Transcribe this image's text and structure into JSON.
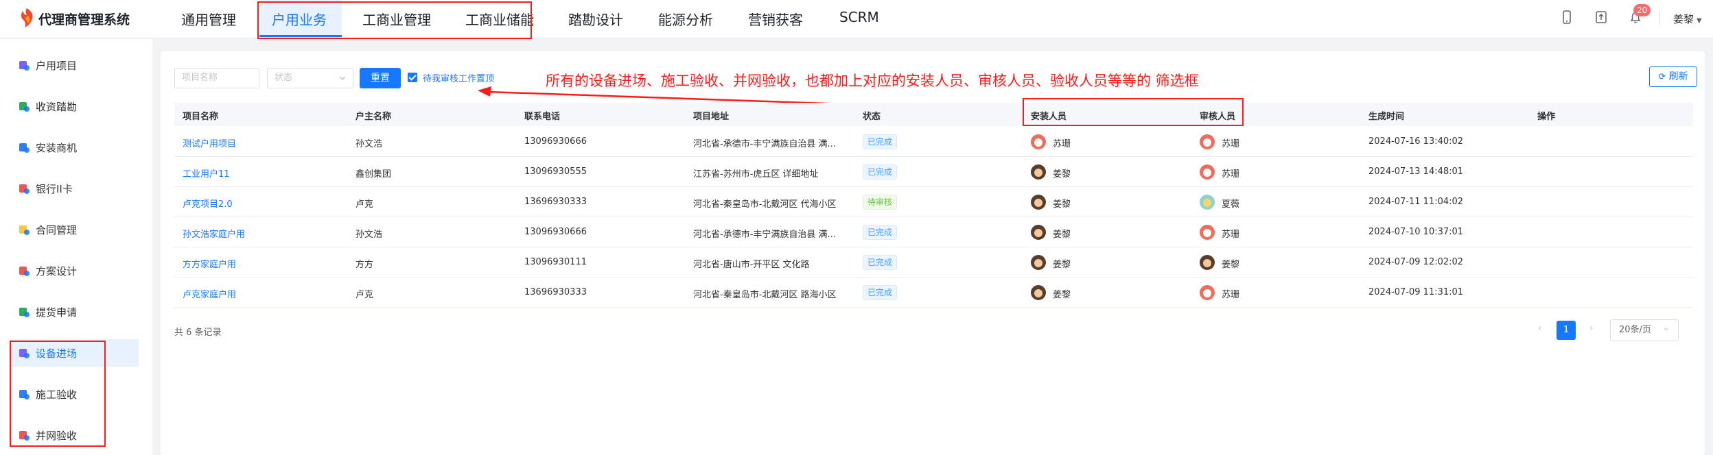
{
  "app": {
    "title": "代理商管理系统"
  },
  "nav": {
    "items": [
      "通用管理",
      "户用业务",
      "工商业管理",
      "工商业储能",
      "踏勘设计",
      "能源分析",
      "营销获客",
      "SCRM"
    ],
    "active_index": 1
  },
  "header": {
    "notification_count": "20",
    "user_name": "姜黎",
    "icons": [
      "mobile-icon",
      "upload-icon",
      "bell-icon"
    ]
  },
  "sidebar": {
    "items": [
      {
        "label": "户用项目",
        "icon": "house-project-icon",
        "color": "#7b61ff"
      },
      {
        "label": "收资踏勘",
        "icon": "survey-icon",
        "color": "#27ae60"
      },
      {
        "label": "安装商机",
        "icon": "opportunity-icon",
        "color": "#2f80ed"
      },
      {
        "label": "银行II卡",
        "icon": "bank-card-icon",
        "color": "#eb5757"
      },
      {
        "label": "合同管理",
        "icon": "contract-icon",
        "color": "#f2c94c"
      },
      {
        "label": "方案设计",
        "icon": "design-icon",
        "color": "#eb5757"
      },
      {
        "label": "提货申请",
        "icon": "pickup-icon",
        "color": "#27ae60"
      },
      {
        "label": "设备进场",
        "icon": "equipment-icon",
        "color": "#7b61ff"
      },
      {
        "label": "施工验收",
        "icon": "construction-icon",
        "color": "#2f80ed"
      },
      {
        "label": "并网验收",
        "icon": "grid-icon",
        "color": "#eb5757"
      }
    ],
    "active_index": 7
  },
  "filters": {
    "project_name_placeholder": "项目名称",
    "status_placeholder": "状态",
    "reset_label": "重置",
    "pin_pending_label": "待我审核工作置顶",
    "refresh_label": "刷新"
  },
  "annotation": "所有的设备进场、施工验收、并网验收，也都加上对应的安装人员、审核人员、验收人员等等的 筛选框",
  "table": {
    "columns": [
      "项目名称",
      "户主名称",
      "联系电话",
      "项目地址",
      "状态",
      "安装人员",
      "审核人员",
      "生成时间",
      "操作"
    ],
    "rows": [
      {
        "project": "测试户用项目",
        "owner": "孙文浩",
        "phone": "13096930666",
        "address": "河北省-承德市-丰宁满族自治县 满...",
        "status": "已完成",
        "installer": "苏珊",
        "reviewer": "苏珊",
        "created": "2024-07-16 13:40:02"
      },
      {
        "project": "工业用户11",
        "owner": "鑫创集团",
        "phone": "13096930555",
        "address": "江苏省-苏州市-虎丘区 详细地址",
        "status": "已完成",
        "installer": "姜黎",
        "reviewer": "苏珊",
        "created": "2024-07-13 14:48:01"
      },
      {
        "project": "卢克项目2.0",
        "owner": "卢克",
        "phone": "13696930333",
        "address": "河北省-秦皇岛市-北戴河区 代海小区",
        "status": "待审核",
        "installer": "姜黎",
        "reviewer": "夏薇",
        "created": "2024-07-11 11:04:02"
      },
      {
        "project": "孙文浩家庭户用",
        "owner": "孙文浩",
        "phone": "13096930666",
        "address": "河北省-承德市-丰宁满族自治县 满...",
        "status": "已完成",
        "installer": "姜黎",
        "reviewer": "苏珊",
        "created": "2024-07-10 10:37:01"
      },
      {
        "project": "方方家庭户用",
        "owner": "方方",
        "phone": "13096930111",
        "address": "河北省-唐山市-开平区 文化路",
        "status": "已完成",
        "installer": "姜黎",
        "reviewer": "姜黎",
        "created": "2024-07-09 12:02:02"
      },
      {
        "project": "卢克家庭户用",
        "owner": "卢克",
        "phone": "13696930333",
        "address": "河北省-秦皇岛市-北戴河区 路海小区",
        "status": "已完成",
        "installer": "姜黎",
        "reviewer": "苏珊",
        "created": "2024-07-09 11:31:01"
      }
    ]
  },
  "pagination": {
    "total_text": "共 6 条记录",
    "current_page": "1",
    "page_size": "20条/页",
    "prev": "‹",
    "next": "›",
    "dropdown": "⌄"
  }
}
